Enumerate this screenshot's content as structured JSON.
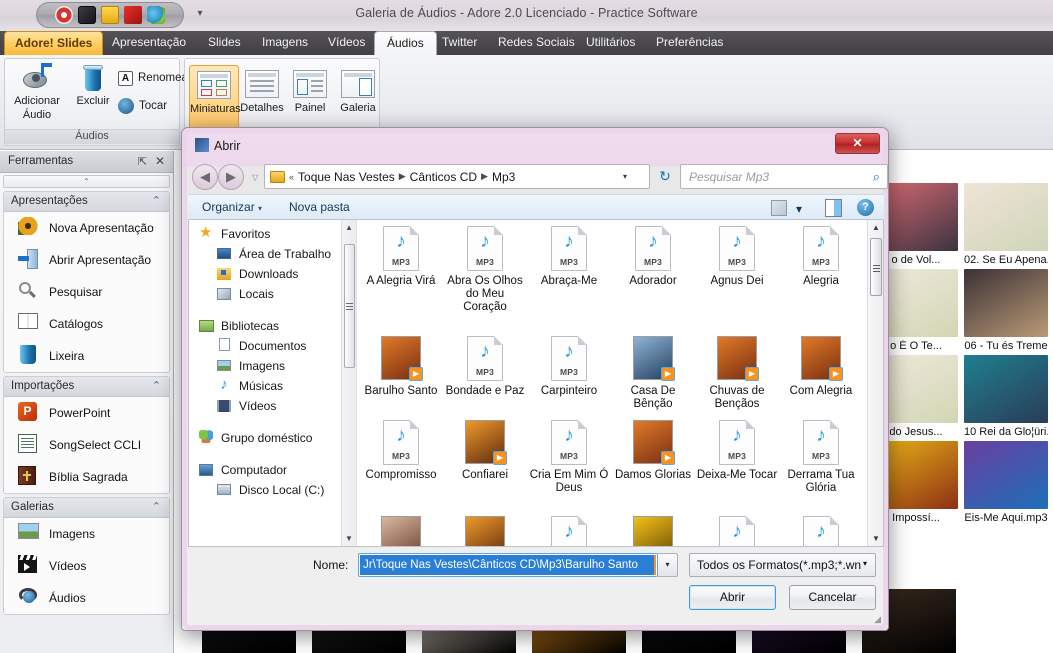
{
  "app": {
    "title": "Galeria de Áudios - Adore 2.0 Licenciado - Practice Software",
    "quick_access_icons": [
      "lifebuoy-icon",
      "disc-icon",
      "bag-icon",
      "ribbon-icon",
      "chat-icon"
    ],
    "quick_access_more": "▾"
  },
  "ribbon_tabs": [
    {
      "label": "Adore! Slides",
      "brand": true
    },
    {
      "label": "Apresentação"
    },
    {
      "label": "Slides"
    },
    {
      "label": "Imagens"
    },
    {
      "label": "Vídeos"
    },
    {
      "label": "Áudios",
      "active": true
    },
    {
      "label": "Twitter"
    },
    {
      "label": "Redes Sociais"
    },
    {
      "label": "Utilitários"
    },
    {
      "label": "Preferências"
    }
  ],
  "ribbon": {
    "group_audios_title": "Áudios",
    "add_audio": "Adicionar\nÁudio",
    "add_audio_l1": "Adicionar",
    "add_audio_l2": "Áudio",
    "delete": "Excluir",
    "rename": "Renomear",
    "play": "Tocar",
    "views": [
      {
        "label": "Miniaturas",
        "selected": true
      },
      {
        "label": "Detalhes",
        "selected": false
      },
      {
        "label": "Painel",
        "selected": false
      },
      {
        "label": "Galeria",
        "selected": false
      }
    ]
  },
  "toolpanel": {
    "title": "Ferramentas",
    "pin": "⇱",
    "close": "✕",
    "sections": [
      {
        "title": "Apresentações",
        "chevron": "⌃",
        "items": [
          {
            "label": "Nova Apresentação",
            "icon": "flower-icon"
          },
          {
            "label": "Abrir Apresentação",
            "icon": "open-door-icon"
          },
          {
            "label": "Pesquisar",
            "icon": "magnifier-icon"
          },
          {
            "label": "Catálogos",
            "icon": "book-icon"
          },
          {
            "label": "Lixeira",
            "icon": "trash-icon"
          }
        ]
      },
      {
        "title": "Importações",
        "chevron": "⌃",
        "items": [
          {
            "label": "PowerPoint",
            "icon": "powerpoint-icon"
          },
          {
            "label": "SongSelect CCLI",
            "icon": "ccli-icon"
          },
          {
            "label": "Bíblia Sagrada",
            "icon": "bible-icon"
          }
        ]
      },
      {
        "title": "Galerias",
        "chevron": "⌃",
        "items": [
          {
            "label": "Imagens",
            "icon": "picture-icon"
          },
          {
            "label": "Vídeos",
            "icon": "clapperboard-icon"
          },
          {
            "label": "Áudios",
            "icon": "headphones-icon"
          }
        ]
      }
    ]
  },
  "gallery": {
    "items": [
      {
        "caption": "o de Vol...",
        "c1": "#d86a72",
        "c2": "#3a3340"
      },
      {
        "caption": "02. Se Eu Apena.",
        "c1": "#efe4d7",
        "c2": "#cfd5b8"
      },
      {
        "caption": "o É O Te...",
        "c1": "#efe9dc",
        "c2": "#d2d6b4"
      },
      {
        "caption": "06 - Tu és Treme",
        "c1": "#3b3136",
        "c2": "#b99a76"
      },
      {
        "caption": "do Jesus...",
        "c1": "#efe9dc",
        "c2": "#d2d6b4"
      },
      {
        "caption": "10 Rei da Glo¦üri.",
        "c1": "#1f7f8f",
        "c2": "#2a3c58"
      },
      {
        "caption": "Impossí...",
        "c1": "#e8b318",
        "c2": "#8d2f14"
      },
      {
        "caption": "Eis-Me Aqui.mp3",
        "c1": "#6a3fa0",
        "c2": "#1d6fb8"
      }
    ],
    "bottom_strip": [
      "#171717",
      "#20201e",
      "#ded4c6",
      "#e8901d",
      "#111111",
      "#2a1540",
      "#3a2a20"
    ]
  },
  "dialog": {
    "title": "Abrir",
    "close_label": "✕",
    "nav_back": "◀",
    "nav_forward": "▶",
    "nav_drop": "▽",
    "breadcrumb_prefix": "«",
    "breadcrumb": [
      "Toque Nas Vestes",
      "Cânticos CD",
      "Mp3"
    ],
    "breadcrumb_chevron": "▾",
    "refresh_icon": "↻",
    "search_placeholder": "Pesquisar Mp3",
    "search_icon": "search-icon",
    "commands": {
      "organize": "Organizar",
      "organize_arrow": "▾",
      "new_folder": "Nova pasta",
      "view_icon": "view-mode-icon",
      "view_arrow": "▾",
      "preview_icon": "preview-pane-icon",
      "help_icon": "help-icon"
    },
    "nav_pane": [
      {
        "label": "Favoritos",
        "icon": "star-icon",
        "level": 1
      },
      {
        "label": "Área de Trabalho",
        "icon": "desktop-icon",
        "level": 2
      },
      {
        "label": "Downloads",
        "icon": "downloads-icon",
        "level": 2
      },
      {
        "label": "Locais",
        "icon": "places-icon",
        "level": 2
      },
      {
        "gap": true
      },
      {
        "label": "Bibliotecas",
        "icon": "libraries-icon",
        "level": 1
      },
      {
        "label": "Documentos",
        "icon": "document-icon",
        "level": 2
      },
      {
        "label": "Imagens",
        "icon": "picture-icon",
        "level": 2
      },
      {
        "label": "Músicas",
        "icon": "music-note-icon",
        "level": 2
      },
      {
        "label": "Vídeos",
        "icon": "film-icon",
        "level": 2
      },
      {
        "gap": true
      },
      {
        "label": "Grupo doméstico",
        "icon": "homegroup-icon",
        "level": 1
      },
      {
        "gap": true
      },
      {
        "label": "Computador",
        "icon": "computer-icon",
        "level": 1
      },
      {
        "label": "Disco Local (C:)",
        "icon": "harddrive-icon",
        "level": 2
      }
    ],
    "files": [
      {
        "name": "A Alegria Virá",
        "type": "mp3"
      },
      {
        "name": "Abra Os Olhos do Meu Coração",
        "type": "mp3"
      },
      {
        "name": "Abraça-Me",
        "type": "mp3"
      },
      {
        "name": "Adorador",
        "type": "mp3"
      },
      {
        "name": "Agnus Dei",
        "type": "mp3"
      },
      {
        "name": "Alegria",
        "type": "mp3"
      },
      {
        "name": "Barulho Santo",
        "type": "art",
        "c1": "#e07a28",
        "c2": "#7a2f12"
      },
      {
        "name": "Bondade e Paz",
        "type": "mp3"
      },
      {
        "name": "Carpinteiro",
        "type": "mp3"
      },
      {
        "name": "Casa De Bênção",
        "type": "art",
        "c1": "#8fb4d6",
        "c2": "#24405e"
      },
      {
        "name": "Chuvas de Bençãos",
        "type": "art",
        "c1": "#e07a28",
        "c2": "#7a2f12"
      },
      {
        "name": "Com Alegria",
        "type": "art",
        "c1": "#e07a28",
        "c2": "#7a2f12"
      },
      {
        "name": "Compromisso",
        "type": "mp3"
      },
      {
        "name": "Confiarei",
        "type": "art",
        "c1": "#f09a28",
        "c2": "#5e2a12"
      },
      {
        "name": "Cria Em Mim Ó Deus",
        "type": "mp3"
      },
      {
        "name": "Damos Glorias",
        "type": "art",
        "c1": "#e07a28",
        "c2": "#7a2f12"
      },
      {
        "name": "Deixa-Me Tocar",
        "type": "mp3"
      },
      {
        "name": "Derrama Tua Glória",
        "type": "mp3"
      }
    ],
    "partial_row": [
      {
        "type": "art",
        "c1": "#d8b8a0",
        "c2": "#6a4030"
      },
      {
        "type": "art",
        "c1": "#f09a28",
        "c2": "#5e2a12"
      },
      {
        "type": "mp3"
      },
      {
        "type": "art",
        "c1": "#f2c21a",
        "c2": "#6a4a05"
      },
      {
        "type": "mp3"
      },
      {
        "type": "mp3"
      }
    ],
    "scroll_up": "▲",
    "scroll_down": "▼",
    "name_label": "Nome:",
    "name_value": "Jr\\Toque Nas Vestes\\Cânticos CD\\Mp3\\Barulho Santo",
    "name_dropdown_arrow": "▾",
    "filter_value": "Todos os Formatos(*.mp3;*.wn",
    "filter_arrow": "▾",
    "open_button": "Abrir",
    "cancel_button": "Cancelar",
    "resize_grip": "◢"
  },
  "colors": {
    "brand_tab": "#f7b73c",
    "dialog_frame": "#ecd4e9",
    "selection_blue": "#2a7fd4",
    "accent_orange": "#f79321"
  }
}
